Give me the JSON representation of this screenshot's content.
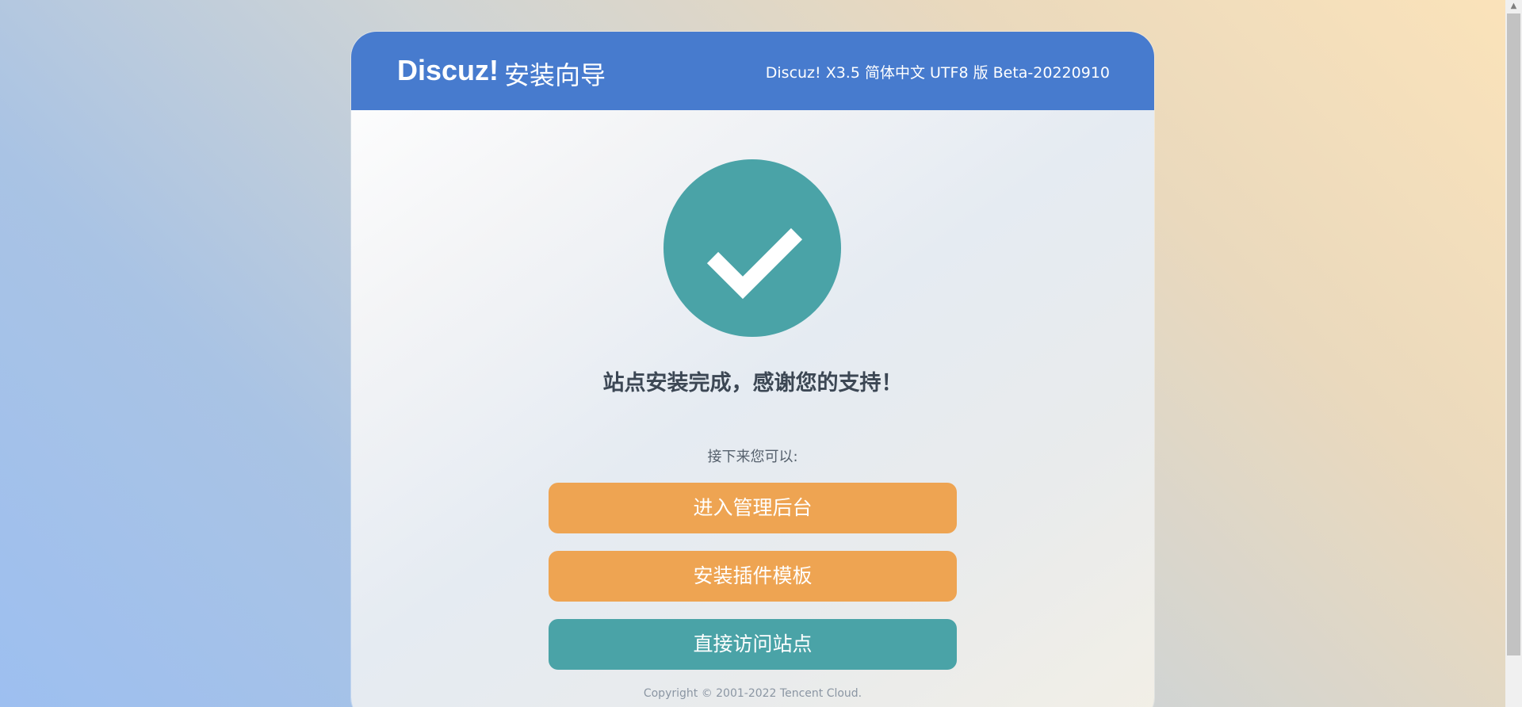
{
  "header": {
    "logo": "Discuz!",
    "wizard_title": "安装向导",
    "version": "Discuz! X3.5 简体中文 UTF8 版 Beta-20220910"
  },
  "main": {
    "status_icon": "checkmark-icon",
    "title": "站点安装完成，感谢您的支持！",
    "next_label": "接下来您可以:",
    "buttons": [
      {
        "label": "进入管理后台",
        "color": "#eea452"
      },
      {
        "label": "安装插件模板",
        "color": "#eea452"
      },
      {
        "label": "直接访问站点",
        "color": "#4aa3a7"
      }
    ]
  },
  "footer": {
    "copyright": "Copyright © 2001-2022 Tencent Cloud."
  },
  "colors": {
    "header_bg": "#477bce",
    "accent_teal": "#4aa3a7",
    "accent_orange": "#eea452"
  }
}
